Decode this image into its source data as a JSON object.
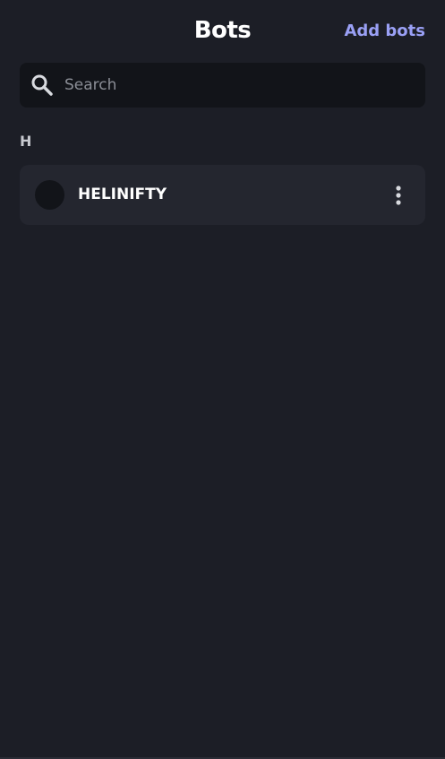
{
  "header": {
    "title": "Bots",
    "add_label": "Add bots"
  },
  "search": {
    "placeholder": "Search",
    "value": ""
  },
  "sections": [
    {
      "letter": "H",
      "bots": [
        {
          "name": "HELINIFTY"
        }
      ]
    }
  ],
  "colors": {
    "background": "#1c1e26",
    "accent": "#9aa0f5",
    "row_background": "#24262f",
    "search_background": "#121419"
  },
  "icons": {
    "search": "search-icon",
    "more": "more-vertical-icon",
    "avatar": "avatar"
  }
}
